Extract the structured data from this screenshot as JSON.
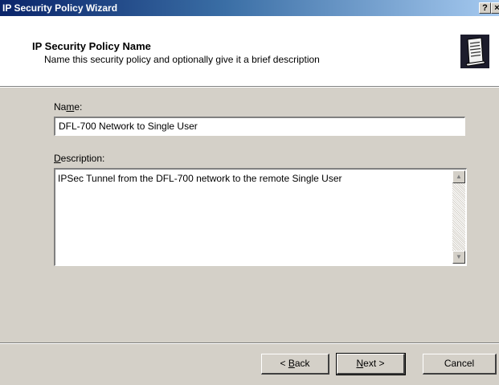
{
  "window": {
    "title": "IP Security Policy Wizard",
    "help_glyph": "?",
    "close_glyph": "×"
  },
  "header": {
    "title": "IP Security Policy Name",
    "subtitle": "Name this security policy and optionally give it a brief description",
    "icon": "policy-document-icon"
  },
  "form": {
    "name_label_pre": "Na",
    "name_label_key": "m",
    "name_label_post": "e:",
    "name_value": "DFL-700 Network to Single User",
    "desc_label_key": "D",
    "desc_label_post": "escription:",
    "description_value": "IPSec Tunnel from the DFL-700 network to the remote Single User"
  },
  "buttons": {
    "back_pre": "< ",
    "back_key": "B",
    "back_post": "ack",
    "next_key": "N",
    "next_post": "ext >",
    "cancel": "Cancel"
  }
}
